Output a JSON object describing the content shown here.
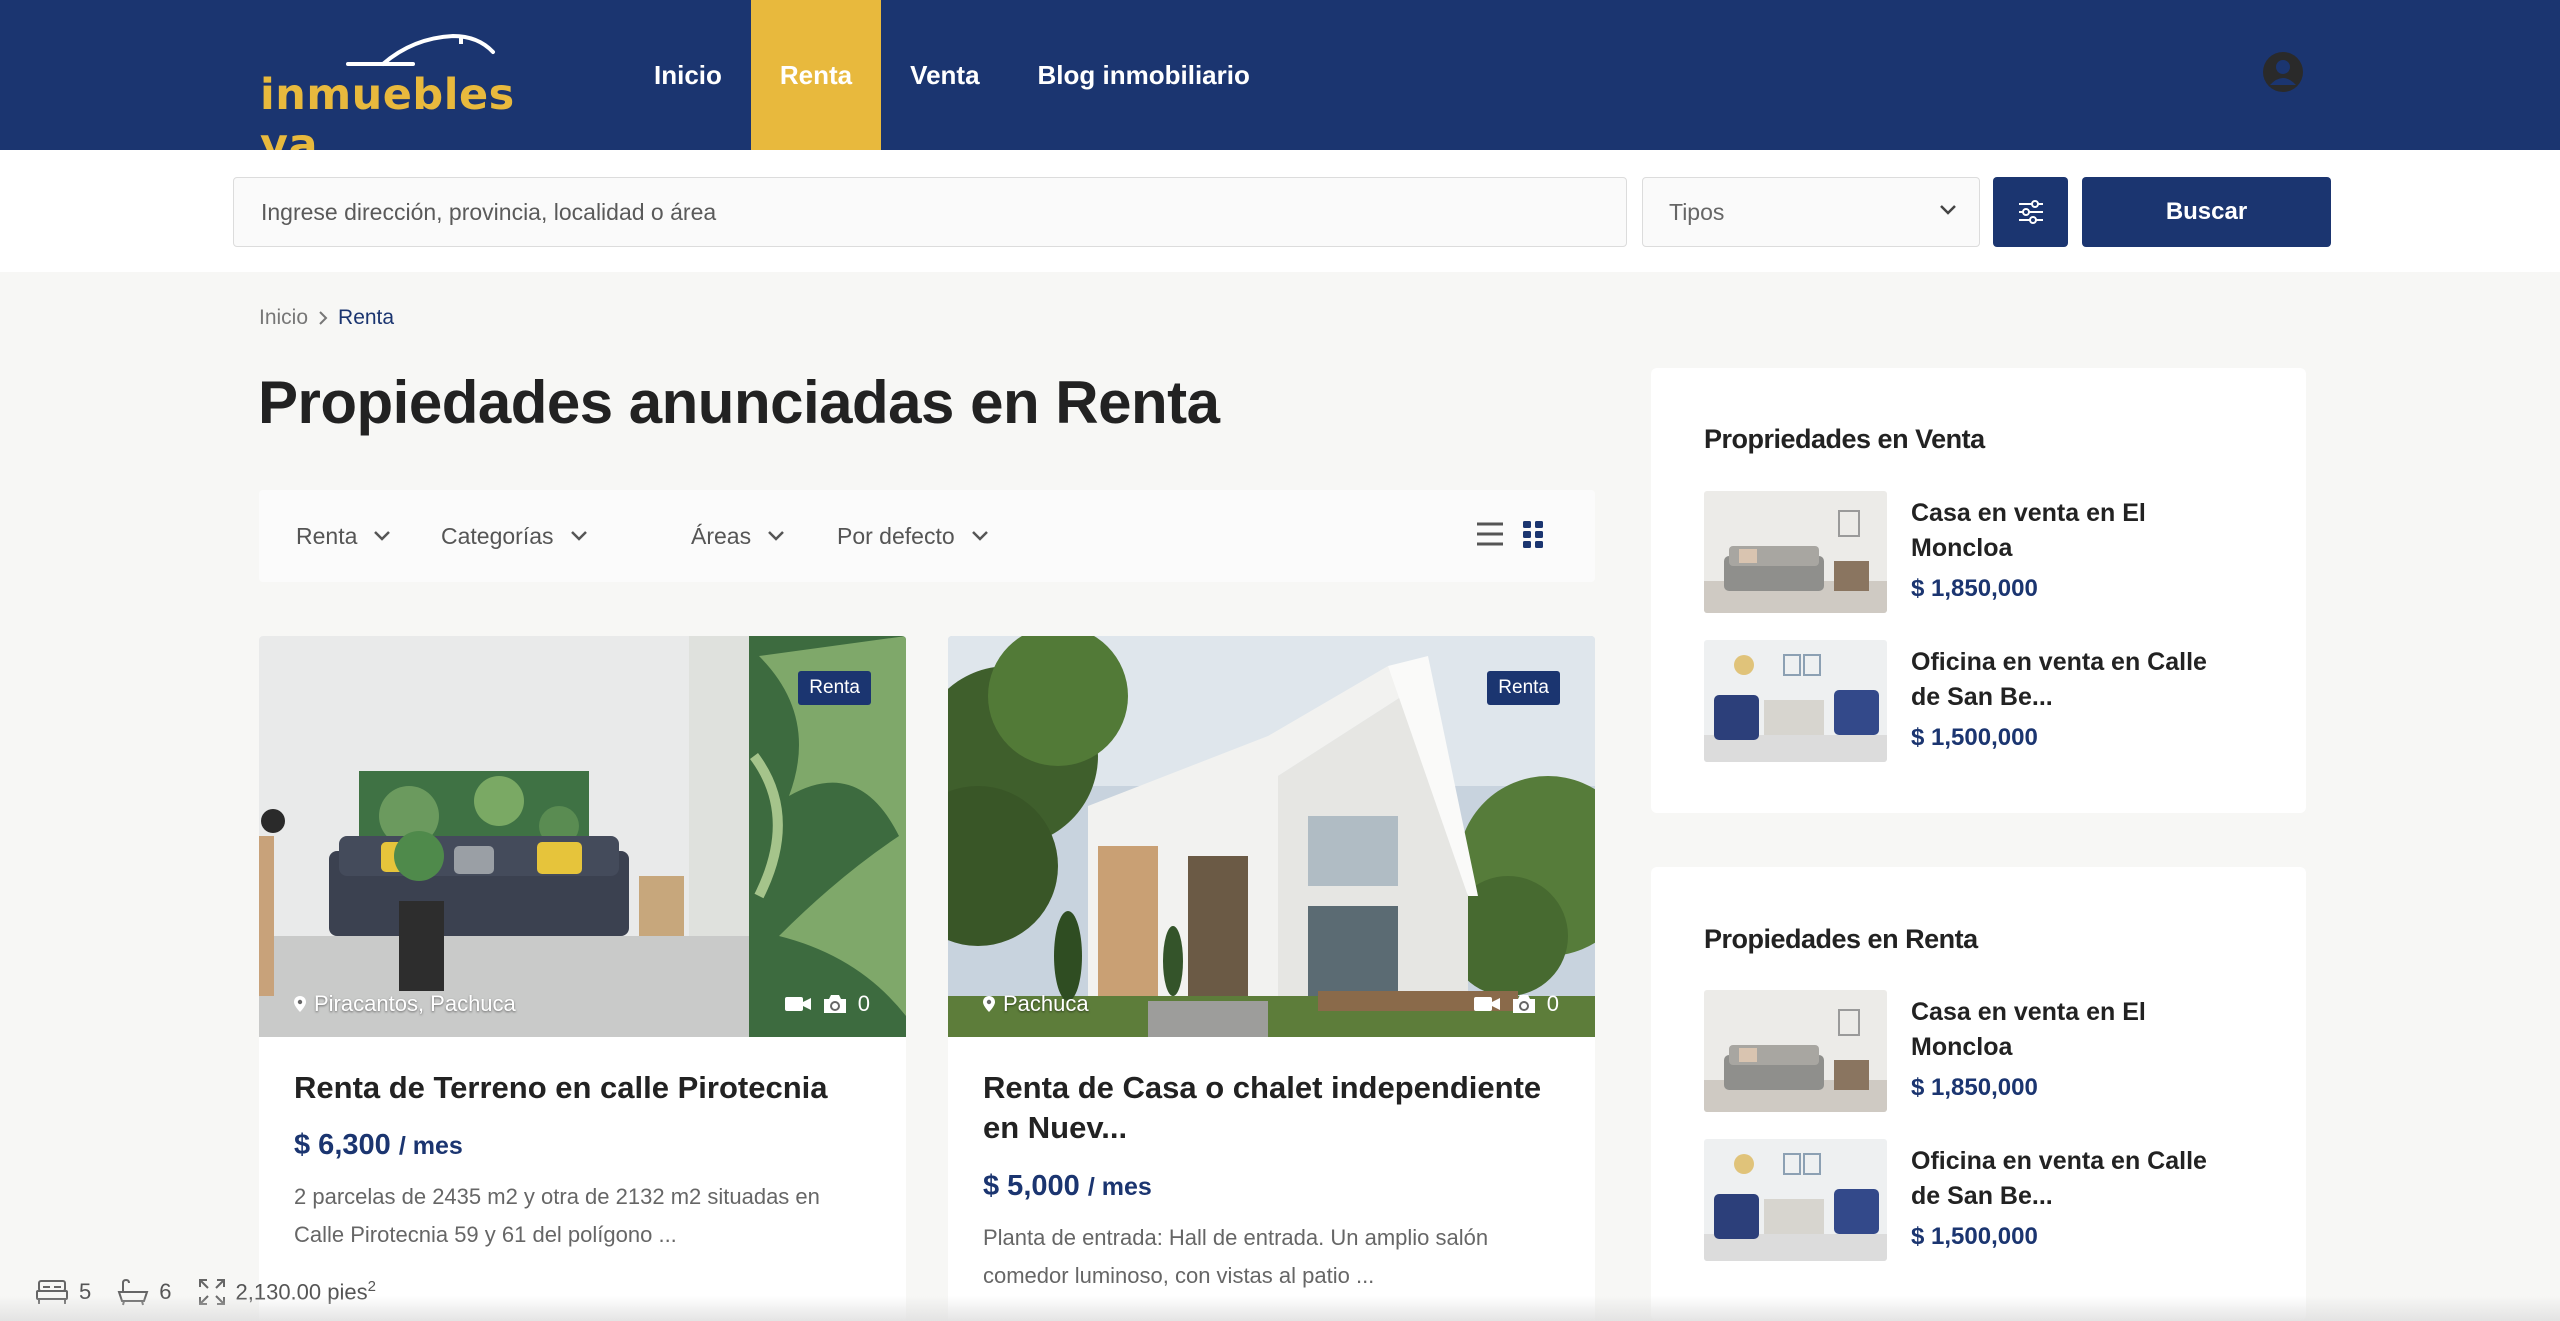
{
  "header": {
    "logo_text": "inmuebles ya",
    "nav": [
      {
        "label": "Inicio",
        "active": false
      },
      {
        "label": "Renta",
        "active": true
      },
      {
        "label": "Venta",
        "active": false
      },
      {
        "label": "Blog inmobiliario",
        "active": false
      }
    ],
    "user_icon": "user-circle-icon"
  },
  "search": {
    "placeholder": "Ingrese dirección, provincia, localidad o área",
    "types_label": "Tipos",
    "filter_icon": "sliders-icon",
    "button_label": "Buscar"
  },
  "breadcrumb": {
    "home": "Inicio",
    "current": "Renta"
  },
  "page_title": "Propiedades anunciadas en Renta",
  "filters": [
    {
      "label": "Renta"
    },
    {
      "label": "Categorías"
    },
    {
      "label": "Áreas"
    },
    {
      "label": "Por defecto"
    }
  ],
  "view_modes": [
    "list-view-icon",
    "grid-view-icon"
  ],
  "listings": [
    {
      "badge": "Renta",
      "location": "Piracantos, Pachuca",
      "photo_count": "0",
      "title": "Renta de Terreno en calle Pirotecnia",
      "price": "$ 6,300",
      "period": "/ mes",
      "description": "2 parcelas de 2435 m2 y otra de 2132 m2 situadas en Calle Pirotecnia 59 y 61 del polígono ...",
      "beds": "5",
      "baths": "6",
      "area": "2,130.00 pies",
      "area_sup": "2"
    },
    {
      "badge": "Renta",
      "location": "Pachuca",
      "photo_count": "0",
      "title": "Renta de Casa o chalet independiente en Nuev...",
      "price": "$ 5,000",
      "period": "/ mes",
      "description": "Planta de entrada: Hall de entrada. Un amplio salón comedor luminoso, con vistas al patio ..."
    }
  ],
  "sidebar": {
    "sale": {
      "title": "Propriedades en Venta",
      "items": [
        {
          "name": "Casa en venta en El Moncloa",
          "price": "$ 1,850,000"
        },
        {
          "name": "Oficina en venta en Calle de San Be...",
          "price": "$ 1,500,000"
        }
      ]
    },
    "rent": {
      "title": "Propiedades en Renta",
      "items": [
        {
          "name": "Casa en venta en El Moncloa",
          "price": "$ 1,850,000"
        },
        {
          "name": "Oficina en venta en Calle de San Be...",
          "price": "$ 1,500,000"
        }
      ]
    }
  },
  "colors": {
    "primary": "#1b3570",
    "accent": "#e8b93d"
  }
}
